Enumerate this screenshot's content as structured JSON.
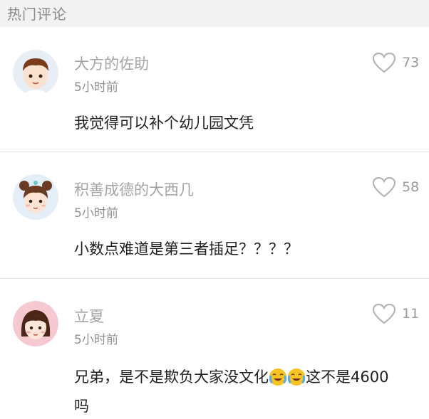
{
  "section": {
    "title": "热门评论"
  },
  "comments": [
    {
      "username": "大方的佐助",
      "time": "5小时前",
      "text": "我觉得可以补个幼儿园文凭",
      "likes": "73",
      "avatar": "boy-avatar"
    },
    {
      "username": "积善成德的大西几",
      "time": "5小时前",
      "text": "小数点难道是第三者插足？？？？",
      "likes": "58",
      "avatar": "girl-buns-avatar"
    },
    {
      "username": "立夏",
      "time": "5小时前",
      "text_before": "兄弟，是不是欺负大家没文化",
      "text_after": "这不是4600",
      "text_wrap": "吗",
      "likes": "11",
      "avatar": "girl-pink-avatar",
      "emoji": "crying-laughing-emoji"
    }
  ],
  "colors": {
    "header_bg": "#f2f2f2",
    "username": "#a4a4a4",
    "body_text": "#222222",
    "heart": "#b5b5b5"
  }
}
